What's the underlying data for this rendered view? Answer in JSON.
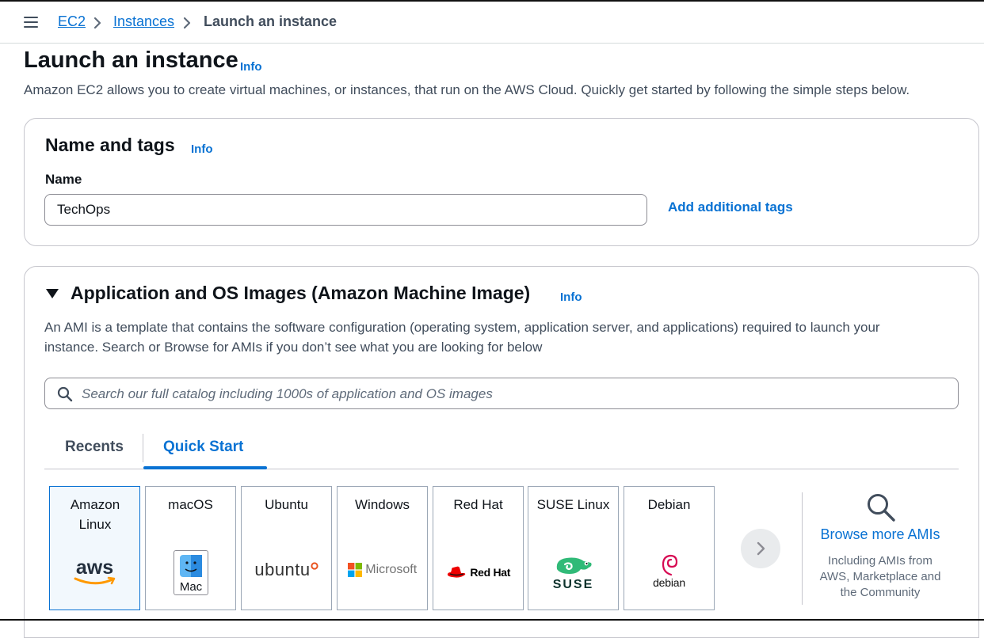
{
  "breadcrumb": {
    "items": [
      "EC2",
      "Instances"
    ],
    "current": "Launch an instance"
  },
  "page": {
    "title": "Launch an instance",
    "info": "Info",
    "description": "Amazon EC2 allows you to create virtual machines, or instances, that run on the AWS Cloud. Quickly get started by following the simple steps below."
  },
  "name_tags": {
    "title": "Name and tags",
    "info": "Info",
    "name_label": "Name",
    "name_value": "TechOps",
    "add_tags": "Add additional tags"
  },
  "ami": {
    "title": "Application and OS Images (Amazon Machine Image)",
    "info": "Info",
    "description_line1": "An AMI is a template that contains the software configuration (operating system, application server, and applications) required to launch your",
    "description_line2": "instance. Search or Browse for AMIs if you don’t see what you are looking for below",
    "search_placeholder": "Search our full catalog including 1000s of application and OS images",
    "tabs": [
      "Recents",
      "Quick Start"
    ],
    "active_tab": "Quick Start",
    "tiles": [
      {
        "name": "Amazon Linux",
        "logo": "aws"
      },
      {
        "name": "macOS",
        "logo": "Mac"
      },
      {
        "name": "Ubuntu",
        "logo": "ubuntu"
      },
      {
        "name": "Windows",
        "logo": "Microsoft"
      },
      {
        "name": "Red Hat",
        "logo": "Red Hat"
      },
      {
        "name": "SUSE Linux",
        "logo": "SUSE"
      },
      {
        "name": "Debian",
        "logo": "debian"
      }
    ],
    "selected_tile": "Amazon Linux",
    "browse": {
      "title": "Browse more AMIs",
      "desc_line1": "Including AMIs from",
      "desc_line2": "AWS, Marketplace and",
      "desc_line3": "the Community"
    }
  },
  "colors": {
    "link": "#0972d3",
    "aws_orange": "#ff9900",
    "redhat_red": "#ee0000",
    "suse_green": "#30ba78",
    "ubuntu_orange": "#e95420",
    "debian_red": "#d70a53"
  }
}
